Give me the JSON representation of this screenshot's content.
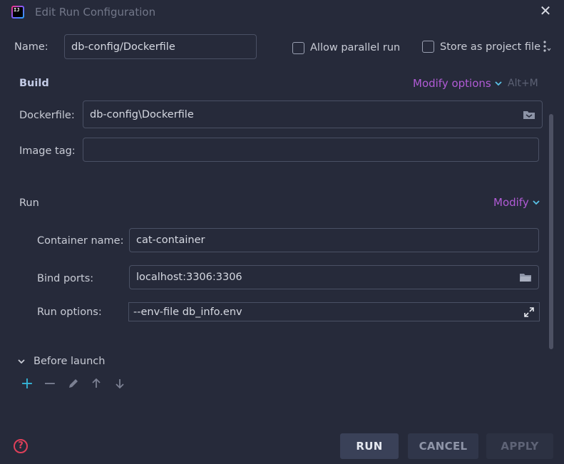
{
  "window": {
    "title": "Edit Run Configuration",
    "app_icon_text": "IJ"
  },
  "header": {
    "name_label": "Name:",
    "name_value": "db-config/Dockerfile",
    "allow_parallel_label": "Allow parallel run",
    "allow_parallel_checked": false,
    "store_project_label": "Store as project file",
    "store_project_checked": false
  },
  "build": {
    "title": "Build",
    "modify_options_label": "Modify options",
    "modify_shortcut": "Alt+M",
    "dockerfile_label": "Dockerfile:",
    "dockerfile_value": "db-config\\Dockerfile",
    "image_tag_label": "Image tag:",
    "image_tag_value": ""
  },
  "run": {
    "title": "Run",
    "modify_label": "Modify",
    "container_name_label": "Container name:",
    "container_name_value": "cat-container",
    "bind_ports_label": "Bind ports:",
    "bind_ports_value": "localhost:3306:3306",
    "run_options_label": "Run options:",
    "run_options_value": "--env-file db_info.env"
  },
  "before_launch": {
    "title": "Before launch",
    "tools": [
      "add-icon",
      "remove-icon",
      "edit-icon",
      "move-up-icon",
      "move-down-icon"
    ]
  },
  "footer": {
    "run_label": "RUN",
    "cancel_label": "CANCEL",
    "apply_label": "APPLY"
  },
  "colors": {
    "background": "#262a3a",
    "accent_link": "#b15bd6",
    "field_border": "#4a5064",
    "help_icon": "#e0405a",
    "add_icon": "#35b6d8"
  }
}
